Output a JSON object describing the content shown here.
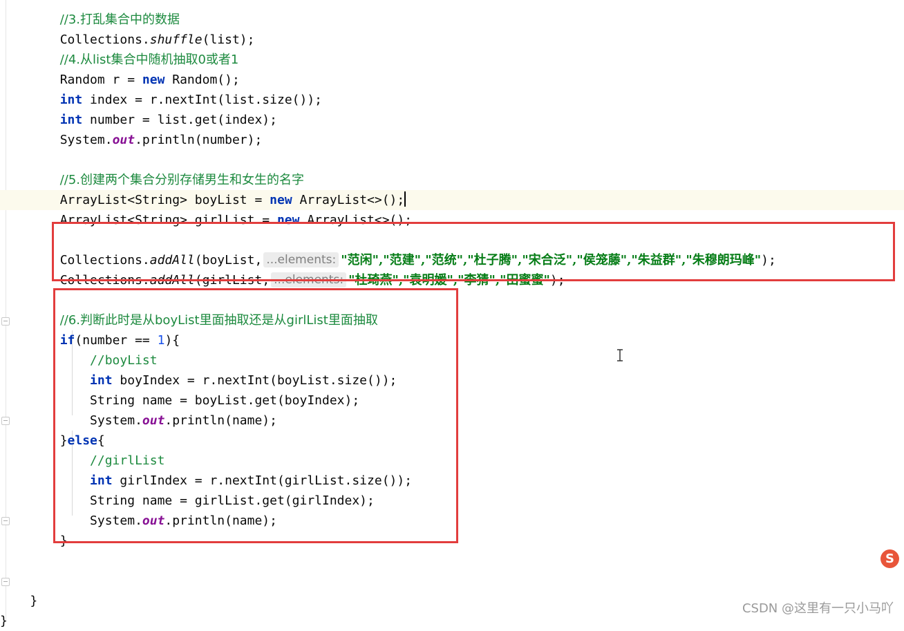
{
  "editor": {
    "lines": [
      {
        "tokens": [
          {
            "t": "        "
          },
          {
            "t": "//3.打乱集合中的数据",
            "c": "comment cjk"
          }
        ]
      },
      {
        "tokens": [
          {
            "t": "        Collections."
          },
          {
            "t": "shuffle",
            "c": "static"
          },
          {
            "t": "(list);"
          }
        ]
      },
      {
        "tokens": [
          {
            "t": "        "
          },
          {
            "t": "//4.从list集合中随机抽取0或者1",
            "c": "comment cjk"
          }
        ]
      },
      {
        "tokens": [
          {
            "t": "        Random r = "
          },
          {
            "t": "new",
            "c": "keyword"
          },
          {
            "t": " Random();"
          }
        ]
      },
      {
        "tokens": [
          {
            "t": "        "
          },
          {
            "t": "int",
            "c": "keyword"
          },
          {
            "t": " index = r.nextInt(list.size());"
          }
        ]
      },
      {
        "tokens": [
          {
            "t": "        "
          },
          {
            "t": "int",
            "c": "keyword"
          },
          {
            "t": " number = list.get(index);"
          }
        ]
      },
      {
        "tokens": [
          {
            "t": "        System."
          },
          {
            "t": "out",
            "c": "field"
          },
          {
            "t": ".println(number);"
          }
        ]
      },
      {
        "tokens": []
      },
      {
        "tokens": [
          {
            "t": "        "
          },
          {
            "t": "//5.创建两个集合分别存储男生和女生的名字",
            "c": "comment cjk"
          }
        ]
      },
      {
        "highlight": true,
        "tokens": [
          {
            "t": "        ArrayList<String> boyList = "
          },
          {
            "t": "new",
            "c": "keyword"
          },
          {
            "t": " ArrayList<>();"
          },
          {
            "caret": true
          }
        ]
      },
      {
        "tokens": [
          {
            "t": "        ArrayList<String> girlList = "
          },
          {
            "t": "new",
            "c": "keyword"
          },
          {
            "t": " ArrayList<>();"
          }
        ]
      },
      {
        "tokens": []
      },
      {
        "tokens": [
          {
            "t": "        Collections."
          },
          {
            "t": "addAll",
            "c": "static"
          },
          {
            "t": "(boyList,"
          },
          {
            "t": "...elements:",
            "c": "hint"
          },
          {
            "t": "\"范闲\",\"范建\",\"范统\",\"杜子腾\",\"宋合泛\",\"侯笼藤\",\"朱益群\",\"朱穆朗玛峰\"",
            "c": "string"
          },
          {
            "t": ");"
          }
        ]
      },
      {
        "tokens": [
          {
            "t": "        Collections."
          },
          {
            "t": "addAll",
            "c": "static"
          },
          {
            "t": "(girlList,"
          },
          {
            "t": "...elements:",
            "c": "hint"
          },
          {
            "t": "\"杜琦燕\",\"袁明媛\",\"李猜\",\"田蜜蜜\"",
            "c": "string"
          },
          {
            "t": ");"
          }
        ]
      },
      {
        "tokens": []
      },
      {
        "tokens": [
          {
            "t": "        "
          },
          {
            "t": "//6.判断此时是从boyList里面抽取还是从girlList里面抽取",
            "c": "comment cjk"
          }
        ]
      },
      {
        "tokens": [
          {
            "t": "        "
          },
          {
            "t": "if",
            "c": "keyword"
          },
          {
            "t": "(number == "
          },
          {
            "t": "1",
            "c": "number"
          },
          {
            "t": "){"
          }
        ]
      },
      {
        "tokens": [
          {
            "t": "            "
          },
          {
            "t": "//boyList",
            "c": "comment"
          }
        ]
      },
      {
        "tokens": [
          {
            "t": "            "
          },
          {
            "t": "int",
            "c": "keyword"
          },
          {
            "t": " boyIndex = r.nextInt(boyList.size());"
          }
        ]
      },
      {
        "tokens": [
          {
            "t": "            String name = boyList.get(boyIndex);"
          }
        ]
      },
      {
        "tokens": [
          {
            "t": "            System."
          },
          {
            "t": "out",
            "c": "field"
          },
          {
            "t": ".println(name);"
          }
        ]
      },
      {
        "tokens": [
          {
            "t": "        }"
          },
          {
            "t": "else",
            "c": "keyword"
          },
          {
            "t": "{"
          }
        ]
      },
      {
        "tokens": [
          {
            "t": "            "
          },
          {
            "t": "//girlList",
            "c": "comment"
          }
        ]
      },
      {
        "tokens": [
          {
            "t": "            "
          },
          {
            "t": "int",
            "c": "keyword"
          },
          {
            "t": " girlIndex = r.nextInt(girlList.size());"
          }
        ]
      },
      {
        "tokens": [
          {
            "t": "            String name = girlList.get(girlIndex);"
          }
        ]
      },
      {
        "tokens": [
          {
            "t": "            System."
          },
          {
            "t": "out",
            "c": "field"
          },
          {
            "t": ".println(name);"
          }
        ]
      },
      {
        "tokens": [
          {
            "t": "        }"
          }
        ]
      },
      {
        "tokens": []
      },
      {
        "tokens": []
      },
      {
        "tokens": [
          {
            "t": "    }"
          }
        ]
      },
      {
        "tokens": [
          {
            "t": "}"
          }
        ]
      }
    ]
  },
  "ime_label": "S",
  "watermark": "CSDN @这里有一只小马吖",
  "colors": {
    "annotation_border": "#e23d3d",
    "comment": "#1d8a3f",
    "keyword": "#0033b3",
    "string": "#067d17",
    "field": "#871094"
  }
}
